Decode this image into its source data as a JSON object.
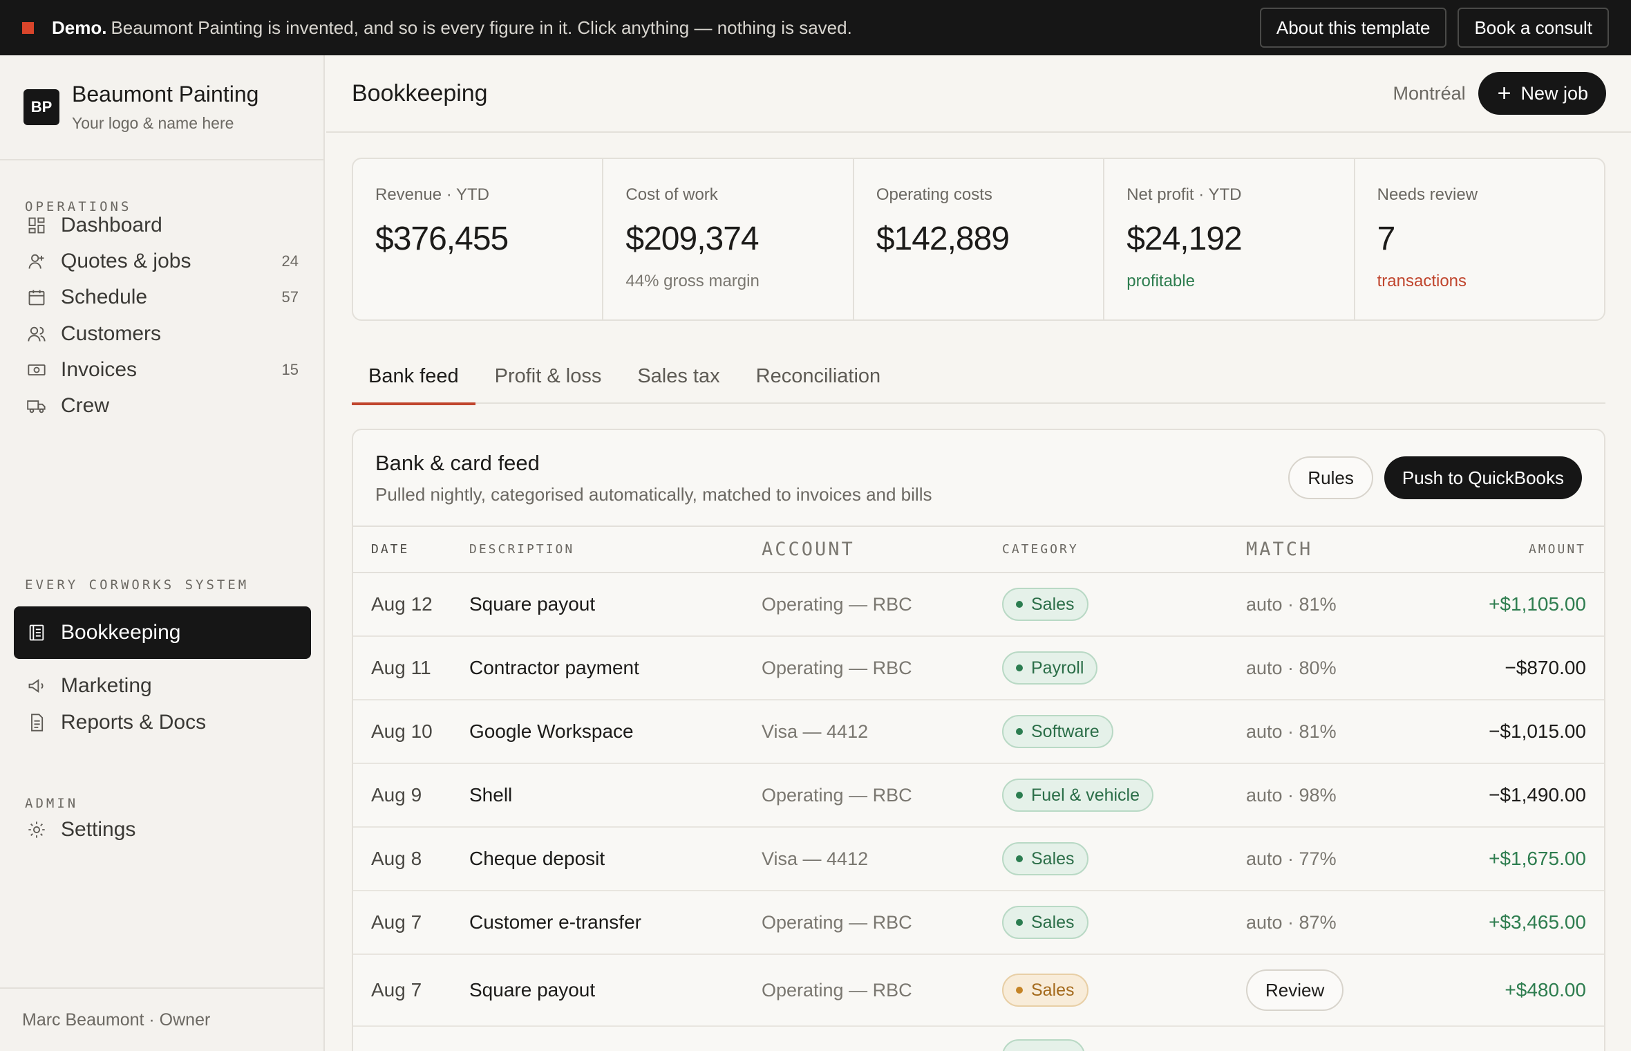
{
  "banner": {
    "strong": "Demo.",
    "message": "Beaumont Painting is invented, and so is every figure in it. Click anything — nothing is saved.",
    "about_label": "About this template",
    "consult_label": "Book a consult"
  },
  "brand": {
    "initials": "BP",
    "name": "Beaumont Painting",
    "subtitle": "Your logo & name here"
  },
  "sidebar": {
    "sections": [
      {
        "label": "OPERATIONS"
      },
      {
        "label": "EVERY CORWORKS SYSTEM"
      },
      {
        "label": "ADMIN"
      }
    ],
    "items": [
      {
        "label": "Dashboard",
        "icon": "dashboard-icon",
        "count": ""
      },
      {
        "label": "Quotes & jobs",
        "icon": "user-plus-icon",
        "count": "24"
      },
      {
        "label": "Schedule",
        "icon": "calendar-icon",
        "count": "57"
      },
      {
        "label": "Customers",
        "icon": "users-icon",
        "count": ""
      },
      {
        "label": "Invoices",
        "icon": "cash-icon",
        "count": "15"
      },
      {
        "label": "Crew",
        "icon": "truck-icon",
        "count": ""
      },
      {
        "label": "Bookkeeping",
        "icon": "ledger-icon",
        "count": ""
      },
      {
        "label": "Marketing",
        "icon": "megaphone-icon",
        "count": ""
      },
      {
        "label": "Reports & Docs",
        "icon": "document-icon",
        "count": ""
      },
      {
        "label": "Settings",
        "icon": "gear-icon",
        "count": ""
      }
    ],
    "footer": "Marc Beaumont · Owner"
  },
  "header": {
    "title": "Bookkeeping",
    "city": "Montréal",
    "new_job_label": "New job"
  },
  "kpis": [
    {
      "label": "Revenue · YTD",
      "value": "$376,455",
      "note": ""
    },
    {
      "label": "Cost of work",
      "value": "$209,374",
      "note": "44% gross margin"
    },
    {
      "label": "Operating costs",
      "value": "$142,889",
      "note": ""
    },
    {
      "label": "Net profit · YTD",
      "value": "$24,192",
      "note": "profitable"
    },
    {
      "label": "Needs review",
      "value": "7",
      "note": "transactions"
    }
  ],
  "tabs": [
    {
      "label": "Bank feed"
    },
    {
      "label": "Profit & loss"
    },
    {
      "label": "Sales tax"
    },
    {
      "label": "Reconciliation"
    }
  ],
  "feed": {
    "title": "Bank & card feed",
    "subtitle": "Pulled nightly, categorised automatically, matched to invoices and bills",
    "rules_label": "Rules",
    "push_label": "Push to QuickBooks",
    "columns": {
      "date": "DATE",
      "description": "DESCRIPTION",
      "account": "ACCOUNT",
      "category": "CATEGORY",
      "match": "MATCH",
      "amount": "AMOUNT"
    },
    "rows": [
      {
        "date": "Aug 12",
        "description": "Square payout",
        "account": "Operating — RBC",
        "category": "Sales",
        "match": "auto · 81%",
        "amount": "+$1,105.00"
      },
      {
        "date": "Aug 11",
        "description": "Contractor payment",
        "account": "Operating — RBC",
        "category": "Payroll",
        "match": "auto · 80%",
        "amount": "−$870.00"
      },
      {
        "date": "Aug 10",
        "description": "Google Workspace",
        "account": "Visa — 4412",
        "category": "Software",
        "match": "auto · 81%",
        "amount": "−$1,015.00"
      },
      {
        "date": "Aug 9",
        "description": "Shell",
        "account": "Operating — RBC",
        "category": "Fuel & vehicle",
        "match": "auto · 98%",
        "amount": "−$1,490.00"
      },
      {
        "date": "Aug 8",
        "description": "Cheque deposit",
        "account": "Visa — 4412",
        "category": "Sales",
        "match": "auto · 77%",
        "amount": "+$1,675.00"
      },
      {
        "date": "Aug 7",
        "description": "Customer e-transfer",
        "account": "Operating — RBC",
        "category": "Sales",
        "match": "auto · 87%",
        "amount": "+$3,465.00"
      },
      {
        "date": "Aug 7",
        "description": "Square payout",
        "account": "Operating — RBC",
        "category": "Sales",
        "match": "Review",
        "amount": "+$480.00"
      }
    ]
  },
  "colors": {
    "accent": "#c0452d",
    "positive": "#2e7d4f",
    "dark": "#161616"
  }
}
